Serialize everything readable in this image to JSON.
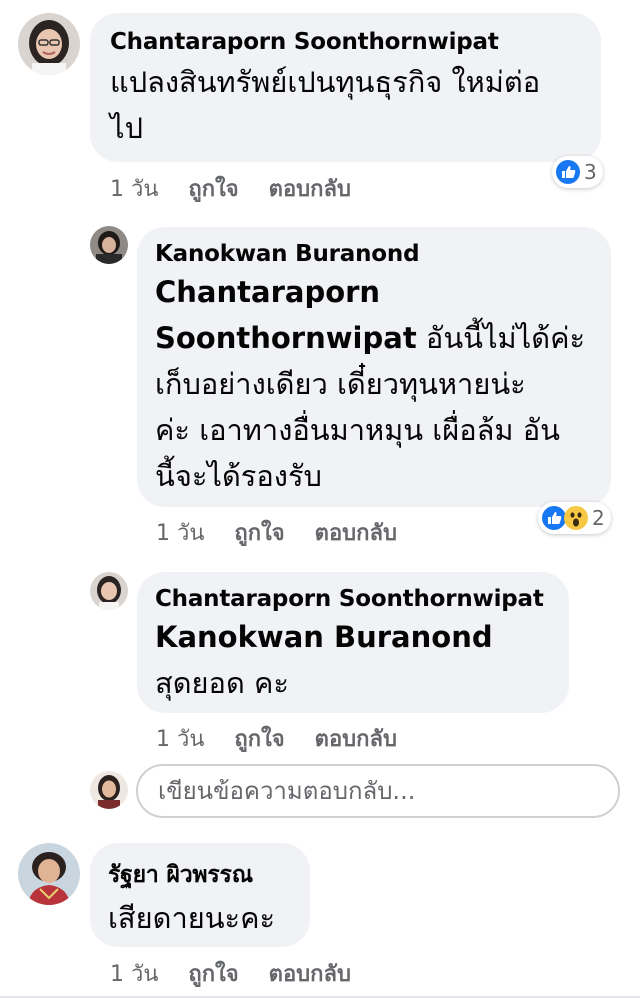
{
  "comments": [
    {
      "author": "Chantaraporn Soonthornwipat",
      "text_lines": [
        "แปลงสินทรัพย์เปนทุนธุรกิจ ใหม่ต่อ",
        "ไป"
      ],
      "time": "1 วัน",
      "like": "ถูกใจ",
      "reply": "ตอบกลับ",
      "reactions": {
        "icons": [
          "like-icon"
        ],
        "count": "3"
      }
    },
    {
      "author": "Kanokwan Buranond",
      "tag_lines": [
        "Chantaraporn",
        "Soonthornwipat"
      ],
      "text_first": "อันนี้ไม่ได้ค่ะ",
      "text_lines": [
        "เก็บอย่างเดียว เดี๋ยวทุนหายน่ะ",
        "ค่ะ เอาทางอื่นมาหมุน เผื่อล้ม อัน",
        "นี้จะได้รองรับ"
      ],
      "time": "1 วัน",
      "like": "ถูกใจ",
      "reply": "ตอบกลับ",
      "reactions": {
        "icons": [
          "like-icon",
          "wow-icon"
        ],
        "count": "2"
      }
    },
    {
      "author": "Chantaraporn Soonthornwipat",
      "tag": "Kanokwan Buranond",
      "text": "สุดยอด คะ",
      "time": "1 วัน",
      "like": "ถูกใจ",
      "reply": "ตอบกลับ"
    },
    {
      "author": "รัฐยา ผิวพรรณ",
      "text": "เสียดายนะคะ",
      "time": "1 วัน",
      "like": "ถูกใจ",
      "reply": "ตอบกลับ"
    }
  ],
  "reply_box": {
    "placeholder": "เขียนข้อความตอบกลับ..."
  },
  "colors": {
    "bubble": "#f0f2f5",
    "meta": "#65676b",
    "like_blue": "#1877f2",
    "wow_yellow": "#f7c844"
  }
}
